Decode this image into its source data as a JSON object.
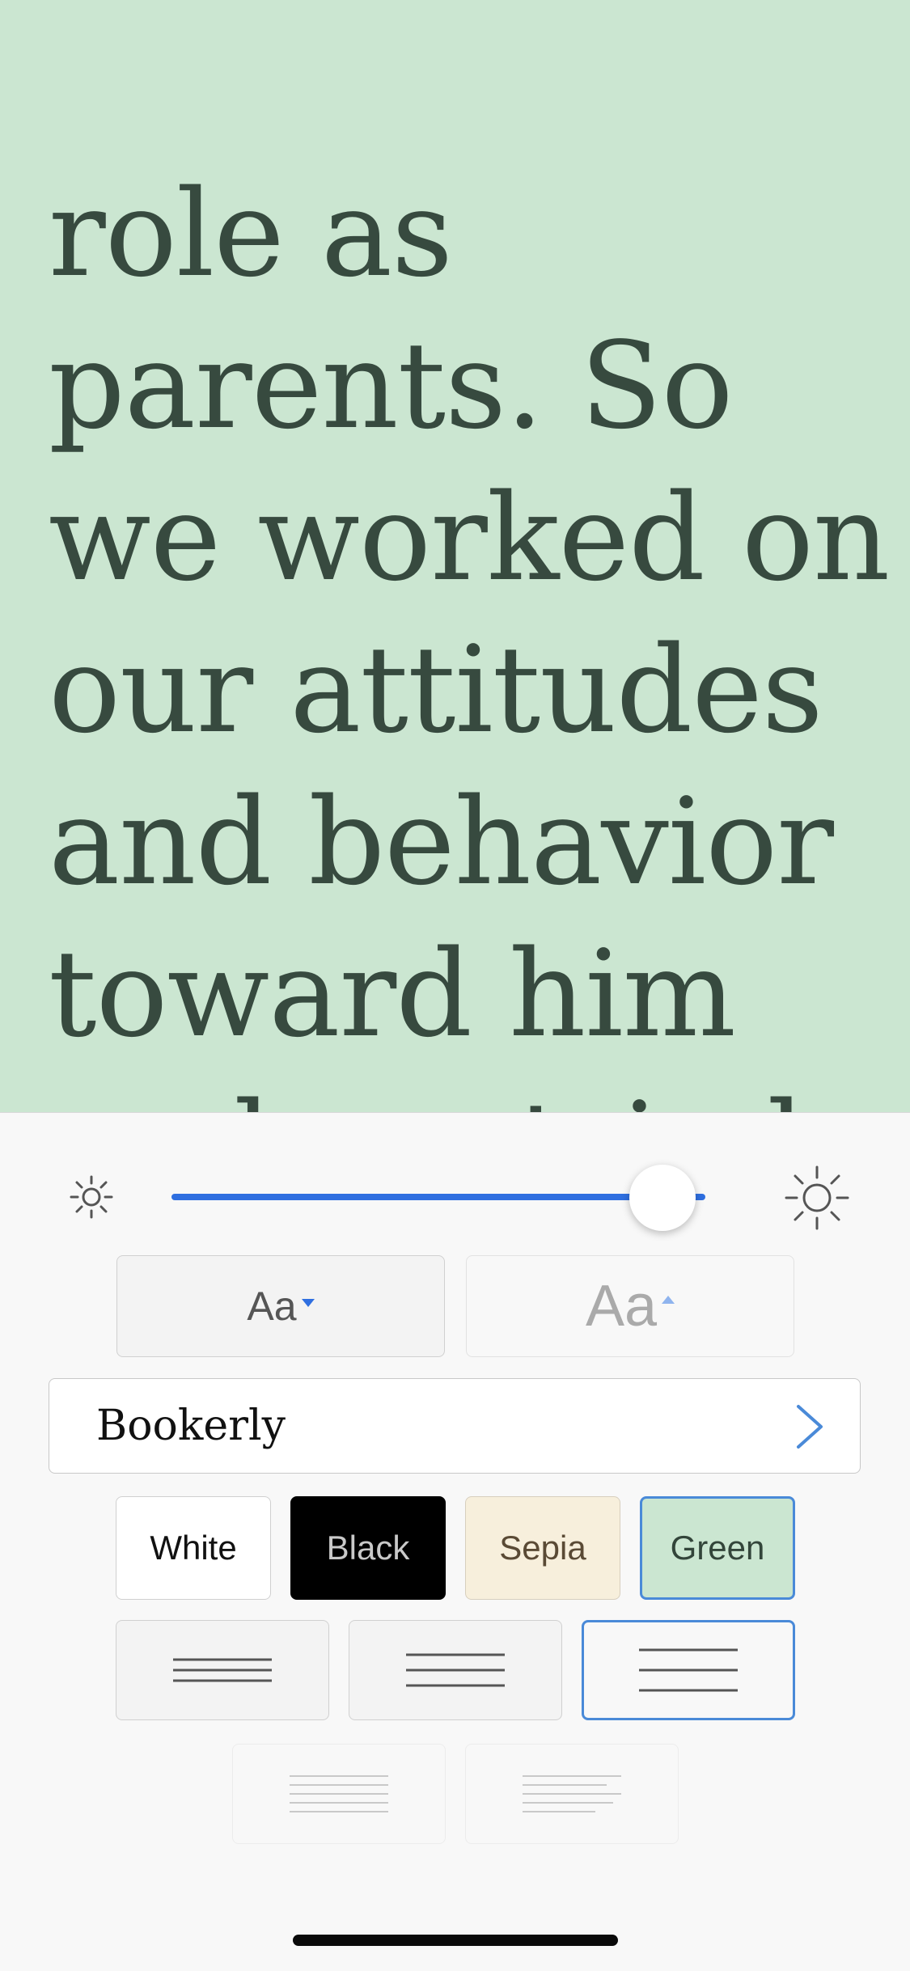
{
  "reader": {
    "lines": [
      "role as",
      "parents. So",
      "we worked on",
      "our attitudes",
      "and behavior",
      "toward him",
      "and we tried"
    ],
    "background_color": "#cbe6d1",
    "text_color": "#374a3f"
  },
  "brightness": {
    "low_icon": "sun-small-icon",
    "high_icon": "sun-large-icon",
    "level": 0.92
  },
  "font_size": {
    "decrease_label": "Aa",
    "increase_label": "Aa"
  },
  "font": {
    "name": "Bookerly",
    "chevron_icon": "chevron-right-icon"
  },
  "themes": [
    {
      "label": "White",
      "selected": false
    },
    {
      "label": "Black",
      "selected": false
    },
    {
      "label": "Sepia",
      "selected": false
    },
    {
      "label": "Green",
      "selected": true
    }
  ],
  "line_spacing": {
    "options": [
      "narrow",
      "medium",
      "wide"
    ],
    "selected": "wide"
  },
  "alignment": {
    "options": [
      "justified",
      "left"
    ]
  },
  "colors": {
    "accent": "#2f6fe0",
    "selected_border": "#4a8ad8"
  }
}
